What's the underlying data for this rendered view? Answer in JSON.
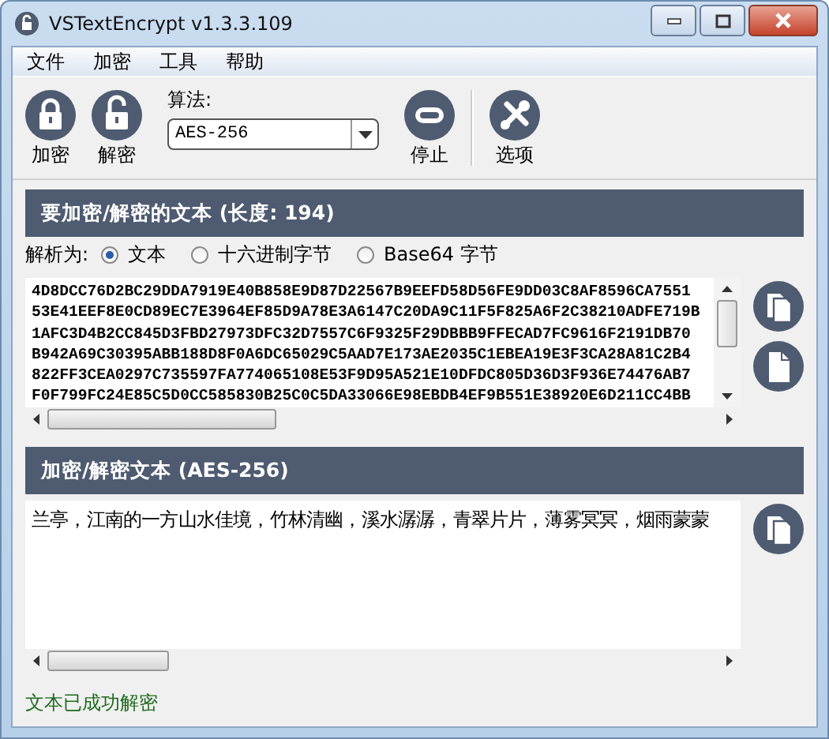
{
  "window": {
    "title": "VSTextEncrypt v1.3.3.109"
  },
  "menu": [
    "文件",
    "加密",
    "工具",
    "帮助"
  ],
  "toolbar": {
    "encrypt": "加密",
    "decrypt": "解密",
    "algorithm_label": "算法:",
    "algorithm": "AES-256",
    "stop": "停止",
    "options": "选项"
  },
  "input_panel": {
    "header": "要加密/解密的文本 (长度: 194)",
    "parse_label": "解析为:",
    "parse_options": [
      {
        "label": "文本",
        "selected": true
      },
      {
        "label": "十六进制字节",
        "selected": false
      },
      {
        "label": "Base64 字节",
        "selected": false
      }
    ],
    "lines": [
      "4D8DCC76D2BC29DDA7919E40B858E9D87D22567B9EEFD58D56FE9DD03C8AF8596CA7551",
      "53E41EEF8E0CD89EC7E3964EF85D9A78E3A6147C20DA9C11F5F825A6F2C38210ADFE719B",
      "1AFC3D4B2CC845D3FBD27973DFC32D7557C6F9325F29DBBB9FFECAD7FC9616F2191DB70",
      "B942A69C30395ABB188D8F0A6DC65029C5AAD7E173AE2035C1EBEA19E3F3CA28A81C2B4",
      "822FF3CEA0297C735597FA774065108E53F9D95A521E10DFDC805D36D3F936E74476AB7",
      "F0F799FC24E85C5D0CC585830B25C0C5DA33066E98EBDB4EF9B551E38920E6D211CC4BB"
    ]
  },
  "output_panel": {
    "header": "加密/解密文本 (AES-256)",
    "text": "兰亭，江南的一方山水佳境，竹林清幽，溪水潺潺，青翠片片，薄雾冥冥，烟雨蒙蒙"
  },
  "status_bar": "文本已成功解密"
}
